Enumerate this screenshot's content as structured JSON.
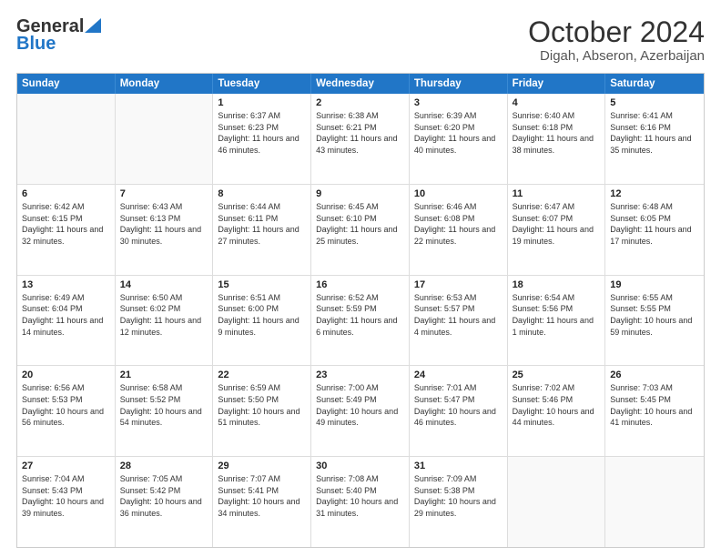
{
  "logo": {
    "general": "General",
    "blue": "Blue"
  },
  "title": "October 2024",
  "subtitle": "Digah, Abseron, Azerbaijan",
  "weekdays": [
    "Sunday",
    "Monday",
    "Tuesday",
    "Wednesday",
    "Thursday",
    "Friday",
    "Saturday"
  ],
  "rows": [
    [
      {
        "day": "",
        "info": ""
      },
      {
        "day": "",
        "info": ""
      },
      {
        "day": "1",
        "info": "Sunrise: 6:37 AM\nSunset: 6:23 PM\nDaylight: 11 hours and 46 minutes."
      },
      {
        "day": "2",
        "info": "Sunrise: 6:38 AM\nSunset: 6:21 PM\nDaylight: 11 hours and 43 minutes."
      },
      {
        "day": "3",
        "info": "Sunrise: 6:39 AM\nSunset: 6:20 PM\nDaylight: 11 hours and 40 minutes."
      },
      {
        "day": "4",
        "info": "Sunrise: 6:40 AM\nSunset: 6:18 PM\nDaylight: 11 hours and 38 minutes."
      },
      {
        "day": "5",
        "info": "Sunrise: 6:41 AM\nSunset: 6:16 PM\nDaylight: 11 hours and 35 minutes."
      }
    ],
    [
      {
        "day": "6",
        "info": "Sunrise: 6:42 AM\nSunset: 6:15 PM\nDaylight: 11 hours and 32 minutes."
      },
      {
        "day": "7",
        "info": "Sunrise: 6:43 AM\nSunset: 6:13 PM\nDaylight: 11 hours and 30 minutes."
      },
      {
        "day": "8",
        "info": "Sunrise: 6:44 AM\nSunset: 6:11 PM\nDaylight: 11 hours and 27 minutes."
      },
      {
        "day": "9",
        "info": "Sunrise: 6:45 AM\nSunset: 6:10 PM\nDaylight: 11 hours and 25 minutes."
      },
      {
        "day": "10",
        "info": "Sunrise: 6:46 AM\nSunset: 6:08 PM\nDaylight: 11 hours and 22 minutes."
      },
      {
        "day": "11",
        "info": "Sunrise: 6:47 AM\nSunset: 6:07 PM\nDaylight: 11 hours and 19 minutes."
      },
      {
        "day": "12",
        "info": "Sunrise: 6:48 AM\nSunset: 6:05 PM\nDaylight: 11 hours and 17 minutes."
      }
    ],
    [
      {
        "day": "13",
        "info": "Sunrise: 6:49 AM\nSunset: 6:04 PM\nDaylight: 11 hours and 14 minutes."
      },
      {
        "day": "14",
        "info": "Sunrise: 6:50 AM\nSunset: 6:02 PM\nDaylight: 11 hours and 12 minutes."
      },
      {
        "day": "15",
        "info": "Sunrise: 6:51 AM\nSunset: 6:00 PM\nDaylight: 11 hours and 9 minutes."
      },
      {
        "day": "16",
        "info": "Sunrise: 6:52 AM\nSunset: 5:59 PM\nDaylight: 11 hours and 6 minutes."
      },
      {
        "day": "17",
        "info": "Sunrise: 6:53 AM\nSunset: 5:57 PM\nDaylight: 11 hours and 4 minutes."
      },
      {
        "day": "18",
        "info": "Sunrise: 6:54 AM\nSunset: 5:56 PM\nDaylight: 11 hours and 1 minute."
      },
      {
        "day": "19",
        "info": "Sunrise: 6:55 AM\nSunset: 5:55 PM\nDaylight: 10 hours and 59 minutes."
      }
    ],
    [
      {
        "day": "20",
        "info": "Sunrise: 6:56 AM\nSunset: 5:53 PM\nDaylight: 10 hours and 56 minutes."
      },
      {
        "day": "21",
        "info": "Sunrise: 6:58 AM\nSunset: 5:52 PM\nDaylight: 10 hours and 54 minutes."
      },
      {
        "day": "22",
        "info": "Sunrise: 6:59 AM\nSunset: 5:50 PM\nDaylight: 10 hours and 51 minutes."
      },
      {
        "day": "23",
        "info": "Sunrise: 7:00 AM\nSunset: 5:49 PM\nDaylight: 10 hours and 49 minutes."
      },
      {
        "day": "24",
        "info": "Sunrise: 7:01 AM\nSunset: 5:47 PM\nDaylight: 10 hours and 46 minutes."
      },
      {
        "day": "25",
        "info": "Sunrise: 7:02 AM\nSunset: 5:46 PM\nDaylight: 10 hours and 44 minutes."
      },
      {
        "day": "26",
        "info": "Sunrise: 7:03 AM\nSunset: 5:45 PM\nDaylight: 10 hours and 41 minutes."
      }
    ],
    [
      {
        "day": "27",
        "info": "Sunrise: 7:04 AM\nSunset: 5:43 PM\nDaylight: 10 hours and 39 minutes."
      },
      {
        "day": "28",
        "info": "Sunrise: 7:05 AM\nSunset: 5:42 PM\nDaylight: 10 hours and 36 minutes."
      },
      {
        "day": "29",
        "info": "Sunrise: 7:07 AM\nSunset: 5:41 PM\nDaylight: 10 hours and 34 minutes."
      },
      {
        "day": "30",
        "info": "Sunrise: 7:08 AM\nSunset: 5:40 PM\nDaylight: 10 hours and 31 minutes."
      },
      {
        "day": "31",
        "info": "Sunrise: 7:09 AM\nSunset: 5:38 PM\nDaylight: 10 hours and 29 minutes."
      },
      {
        "day": "",
        "info": ""
      },
      {
        "day": "",
        "info": ""
      }
    ]
  ]
}
